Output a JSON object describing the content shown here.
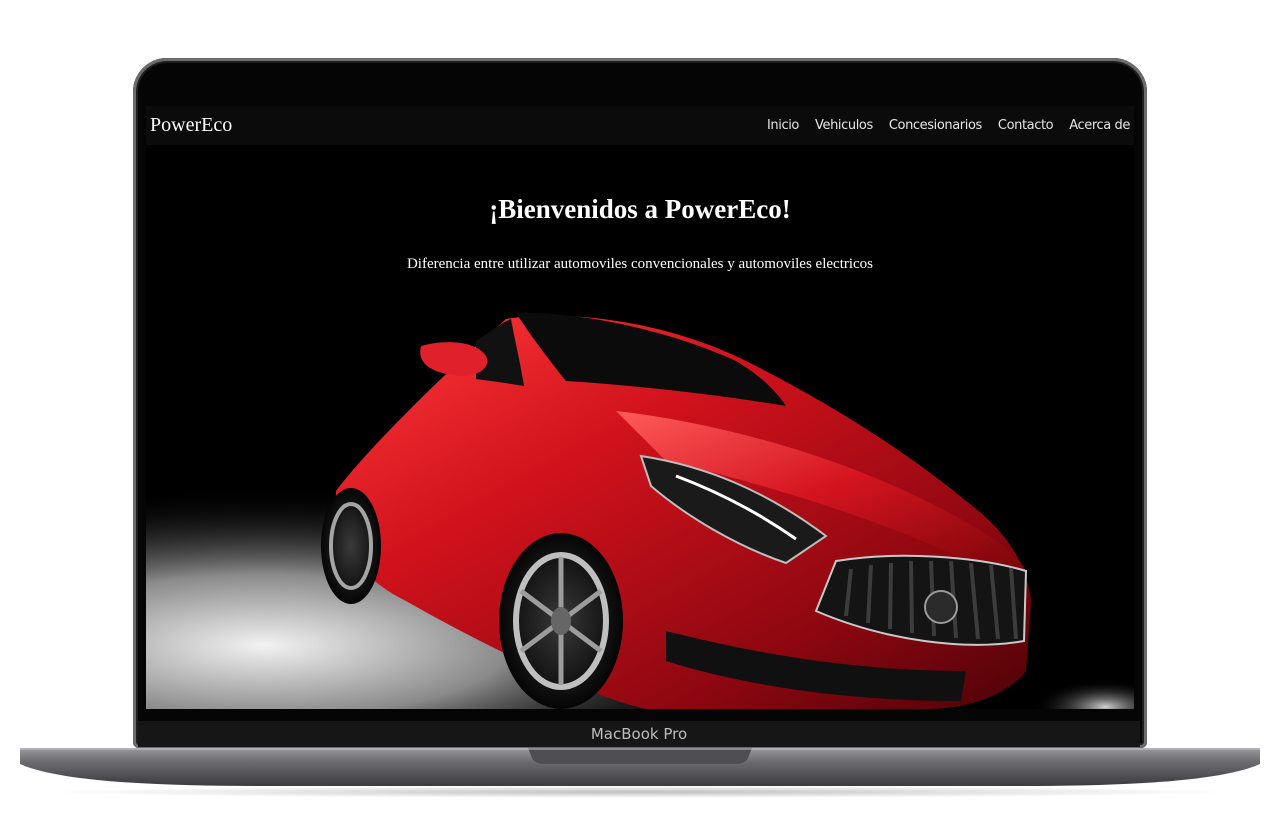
{
  "device": {
    "label": "MacBook Pro"
  },
  "site": {
    "brand": "PowerEco",
    "nav": [
      {
        "label": "Inicio"
      },
      {
        "label": "Vehiculos"
      },
      {
        "label": "Concesionarios"
      },
      {
        "label": "Contacto"
      },
      {
        "label": "Acerca de"
      }
    ],
    "hero": {
      "title": "¡Bienvenidos a PowerEco!",
      "subtitle": "Diferencia entre utilizar automoviles convencionales y automoviles electricos"
    }
  },
  "colors": {
    "page_bg": "#000000",
    "navbar_bg": "#0b0b0b",
    "car_red": "#c8101c"
  }
}
